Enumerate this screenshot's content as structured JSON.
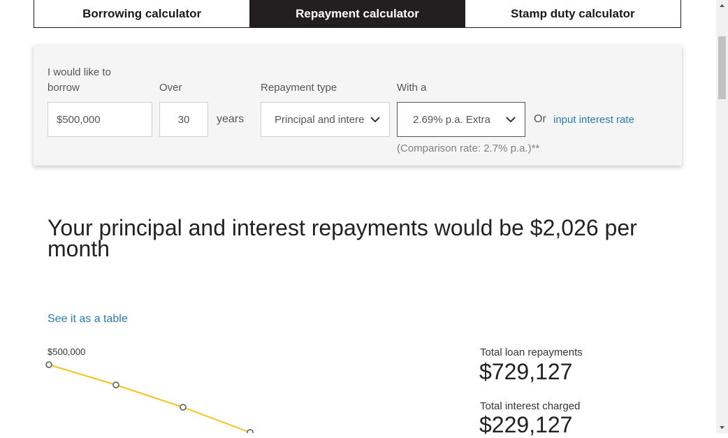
{
  "tabs": [
    {
      "label": "Borrowing calculator",
      "active": false
    },
    {
      "label": "Repayment calculator",
      "active": true
    },
    {
      "label": "Stamp duty calculator",
      "active": false
    }
  ],
  "form": {
    "borrow_label": "I would like to borrow",
    "borrow_value": "$500,000",
    "over_label": "Over",
    "term_value": "30",
    "term_unit": "years",
    "repayment_type_label": "Repayment type",
    "repayment_type_value": "Principal and interest",
    "rate_label": "With a",
    "rate_value": "2.69% p.a. Extra",
    "or_text": "Or",
    "input_rate_link": "input interest rate",
    "comparison_note": "(Comparison rate: 2.7% p.a.)**"
  },
  "result": {
    "headline": "Your principal and interest repayments would be $2,026 per month",
    "see_table_link": "See it as a table"
  },
  "chart_data": {
    "type": "line",
    "start_label": "$500,000",
    "color": "#f2c31b"
  },
  "stats": {
    "total_repayments_label": "Total loan repayments",
    "total_repayments_value": "$729,127",
    "total_interest_label": "Total interest charged",
    "total_interest_value": "$229,127"
  },
  "colors": {
    "tab_active_bg": "#231f20",
    "link": "#2a7ab0",
    "chart_line": "#f2c31b"
  },
  "icons": {
    "select_chevron": "chevron-down-icon",
    "scroll_up": "scroll-up-arrow-icon",
    "scroll_down": "scroll-down-arrow-icon"
  }
}
